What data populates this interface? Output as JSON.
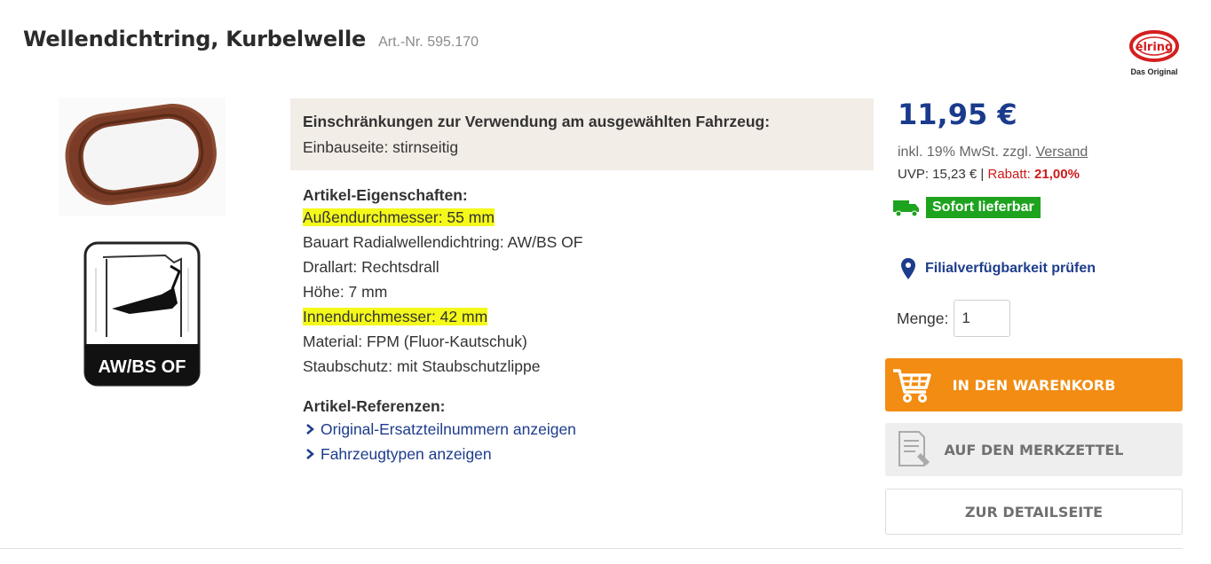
{
  "product": {
    "title": "Wellendichtring, Kurbelwelle",
    "article_number": "Art.-Nr. 595.170",
    "brand_tagline": "Das Original",
    "image_badge": "AW/BS OF"
  },
  "restriction": {
    "title": "Einschränkungen zur Verwendung am ausgewählten Fahrzeug:",
    "text": "Einbauseite: stirnseitig"
  },
  "properties": {
    "heading": "Artikel-Eigenschaften:",
    "items": [
      {
        "text": "Außendurchmesser: 55 mm",
        "highlighted": true
      },
      {
        "text": "Bauart Radialwellendichtring: AW/BS OF",
        "highlighted": false
      },
      {
        "text": "Drallart: Rechtsdrall",
        "highlighted": false
      },
      {
        "text": "Höhe: 7 mm",
        "highlighted": false
      },
      {
        "text": "Innendurchmesser: 42 mm",
        "highlighted": true
      },
      {
        "text": "Material: FPM (Fluor-Kautschuk)",
        "highlighted": false
      },
      {
        "text": "Staubschutz: mit Staubschutzlippe",
        "highlighted": false
      }
    ]
  },
  "references": {
    "heading": "Artikel-Referenzen:",
    "links": [
      {
        "label": "Original-Ersatzteilnummern anzeigen"
      },
      {
        "label": "Fahrzeugtypen anzeigen"
      }
    ]
  },
  "pricing": {
    "price": "11,95 €",
    "tax_prefix": "inkl. 19% MwSt. zzgl.",
    "shipping_link": "Versand",
    "uvp": "UVP: 15,23 €",
    "separator": "|",
    "rabatt_label": "Rabatt:",
    "rabatt_value": "21,00%"
  },
  "availability": {
    "status": "Sofort lieferbar",
    "status_color": "#1ea31e",
    "branch_check": "Filialverfügbarkeit prüfen"
  },
  "quantity": {
    "label": "Menge:",
    "value": "1"
  },
  "buttons": {
    "cart": "IN DEN WARENKORB",
    "memo": "AUF DEN MERKZETTEL",
    "details": "ZUR DETAILSEITE"
  },
  "colors": {
    "accent_orange": "#f28c12",
    "price_blue": "#1a3b8c",
    "link_blue": "#1d3c8c",
    "highlight_yellow": "#f4f91a",
    "discount_red": "#cc1a1a"
  },
  "icons": {
    "logo": "elring-logo",
    "truck": "truck-icon",
    "pin": "location-pin-icon",
    "cart": "shopping-cart-icon",
    "memo": "notepad-pencil-icon",
    "chevron": "chevron-right-icon"
  }
}
